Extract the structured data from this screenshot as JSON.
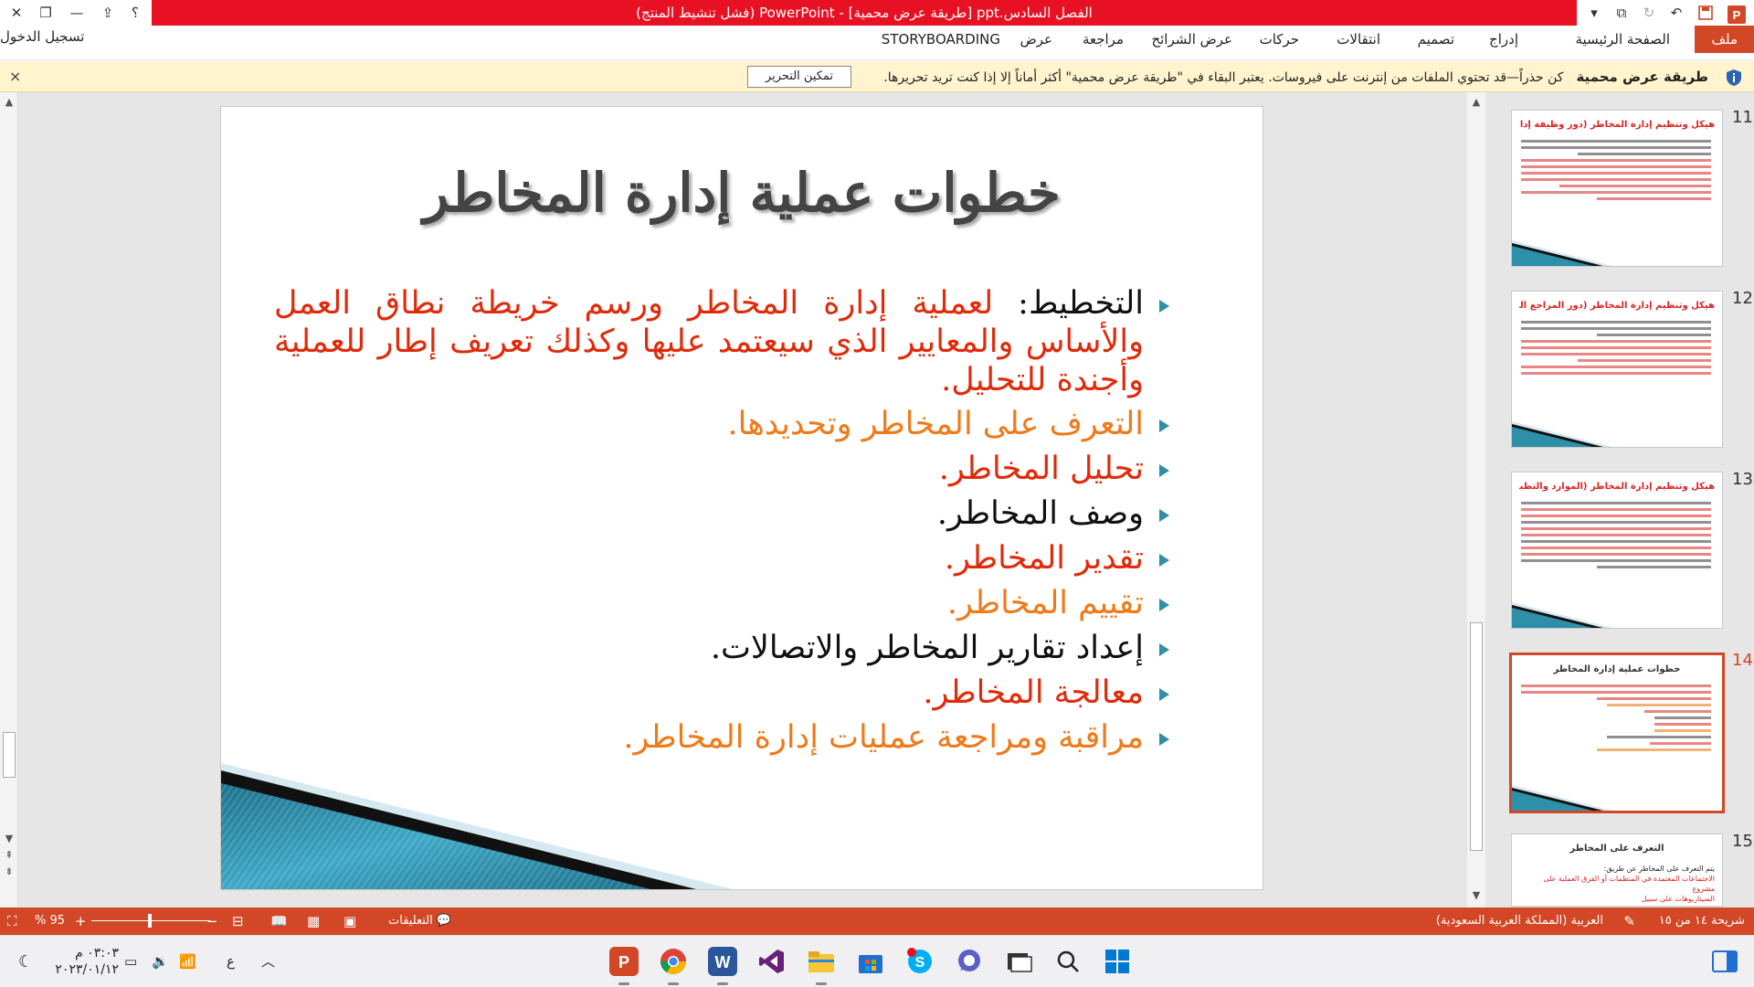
{
  "window": {
    "title": "الفصل السادس.ppt [طريقة عرض محمية] - PowerPoint (فشل تنشيط المنتج)",
    "help_label": "؟",
    "sign_in": "تسجيل الدخول"
  },
  "ribbon": {
    "tabs": [
      "ملف",
      "الصفحة الرئيسية",
      "إدراج",
      "تصميم",
      "انتقالات",
      "حركات",
      "عرض الشرائح",
      "مراجعة",
      "عرض",
      "STORYBOARDING"
    ]
  },
  "protected_view": {
    "label": "طريقة عرض محمية",
    "message": "كن حذراً—قد تحتوي الملفات من إنترنت على فيروسات. يعتبر البقاء في \"طريقة عرض محمية\" أكثر أماناً إلا إذا كنت تريد تحريرها.",
    "enable_button": "تمكين التحرير",
    "close_label": "×"
  },
  "slide": {
    "title": "خطوات عملية إدارة المخاطر",
    "bullets": [
      {
        "lead": "التخطيط: ",
        "text": "لعملية إدارة المخاطر ورسم خريطة نطاق العمل والأساس والمعايير الذي سيعتمد عليها وكذلك تعريف إطار للعملية وأجندة للتحليل.",
        "lead_color": "#111111",
        "color": "#e02a0a"
      },
      {
        "lead": "",
        "text": "التعرف على المخاطر وتحديدها.",
        "color": "#f07a1a"
      },
      {
        "lead": "",
        "text": "تحليل المخاطر.",
        "color": "#e02a0a"
      },
      {
        "lead": "",
        "text": "وصف المخاطر.",
        "color": "#111111"
      },
      {
        "lead": "",
        "text": "تقدير المخاطر.",
        "color": "#e02a0a"
      },
      {
        "lead": "",
        "text": "تقييم المخاطر.",
        "color": "#f07a1a"
      },
      {
        "lead": "",
        "text": "إعداد تقارير المخاطر والاتصالات.",
        "color": "#111111"
      },
      {
        "lead": "",
        "text": "معالجة المخاطر.",
        "color": "#e02a0a"
      },
      {
        "lead": "",
        "text": "مراقبة ومراجعة عمليات إدارة المخاطر.",
        "color": "#f07a1a"
      }
    ]
  },
  "thumbnails": [
    {
      "number": "11",
      "title": "هيكل وتنظيم إدارة المخاطر (دور وظيفة إدارة المخاطر)"
    },
    {
      "number": "12",
      "title": "هيكل وتنظيم إدارة المخاطر (دور المراجع الداخلي)"
    },
    {
      "number": "13",
      "title": "هيكل وتنظيم إدارة المخاطر (الموارد والتطبيق)"
    },
    {
      "number": "14",
      "title": "خطوات عملية إدارة المخاطر",
      "active": true
    },
    {
      "number": "15",
      "title": "التعرف على المخاطر"
    }
  ],
  "thumb15": {
    "line1": "يتم التعرف على المخاطر عن طريق:",
    "line2": "الاجتماعات المعتمدة في المنظمات أو الفرق العملية على مشروع",
    "line3": "السيناريوهات على سبيل"
  },
  "status": {
    "slide_info": "شريحة ١٤ من ١٥",
    "language": "العربية (المملكة العربية السعودية)",
    "comments": "التعليقات",
    "zoom": "95 %"
  },
  "taskbar": {
    "time": "٠٣:٠٣ م",
    "date": "٢٠٢٣/٠١/١٢",
    "lang": "ع",
    "apps": [
      "powerpoint",
      "chrome",
      "word",
      "visual-studio",
      "file-explorer",
      "store",
      "skype",
      "teams-chat",
      "desktop-app",
      "search",
      "windows-start"
    ]
  },
  "colors": {
    "accent": "#d24726",
    "titlebar": "#e81123",
    "protected_bar": "#fff4ce",
    "teal": "#2e8fa8"
  }
}
